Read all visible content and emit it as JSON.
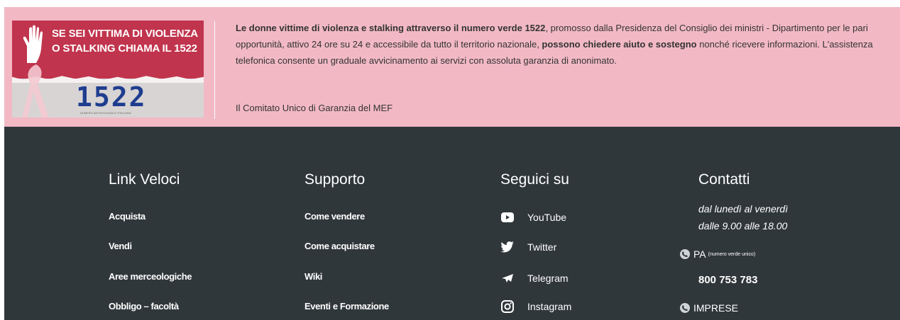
{
  "banner": {
    "promo": {
      "line1": "SE SEI VITTIMA DI VIOLENZA",
      "line2": "O STALKING CHIAMA IL 1522",
      "number": "1522",
      "small": "NUMERO ANTIVIOLENZA E STALKING"
    },
    "text_bold1": "Le donne vittime di violenza e stalking attraverso il numero verde 1522",
    "text_part2": ", promosso dalla Presidenza del Consiglio dei ministri - Dipartimento per le pari opportunità, attivo 24 ore su 24 e accessibile da tutto il territorio nazionale, ",
    "text_bold2": "possono chiedere aiuto e sostegno",
    "text_part3": " nonché ricevere informazioni. L'assistenza telefonica consente un graduale avvicinamento ai servizi con assoluta garanzia di anonimato.",
    "signature": "Il Comitato Unico di Garanzia del MEF"
  },
  "footer": {
    "link_veloci": {
      "heading": "Link Veloci",
      "items": [
        "Acquista",
        "Vendi",
        "Aree merceologiche",
        "Obbligo – facoltà"
      ]
    },
    "supporto": {
      "heading": "Supporto",
      "items": [
        "Come vendere",
        "Come acquistare",
        "Wiki",
        "Eventi e Formazione"
      ]
    },
    "seguici": {
      "heading": "Seguici su",
      "items": [
        {
          "label": "YouTube",
          "icon": "youtube-icon"
        },
        {
          "label": "Twitter",
          "icon": "twitter-icon"
        },
        {
          "label": "Telegram",
          "icon": "telegram-icon"
        },
        {
          "label": "Instagram",
          "icon": "instagram-icon"
        }
      ]
    },
    "contatti": {
      "heading": "Contatti",
      "hours_line1": "dal lunedì al venerdì",
      "hours_line2": "dalle 9.00 alle 18.00",
      "pa_label": "PA",
      "pa_note": "(numero verde unico)",
      "pa_number": "800 753 783",
      "imprese_label": "IMPRESE"
    }
  },
  "colors": {
    "banner_bg": "#f2b9c5",
    "footer_bg": "#30373b",
    "promo_red": "#c1344d",
    "promo_blue": "#1f3d8f"
  }
}
